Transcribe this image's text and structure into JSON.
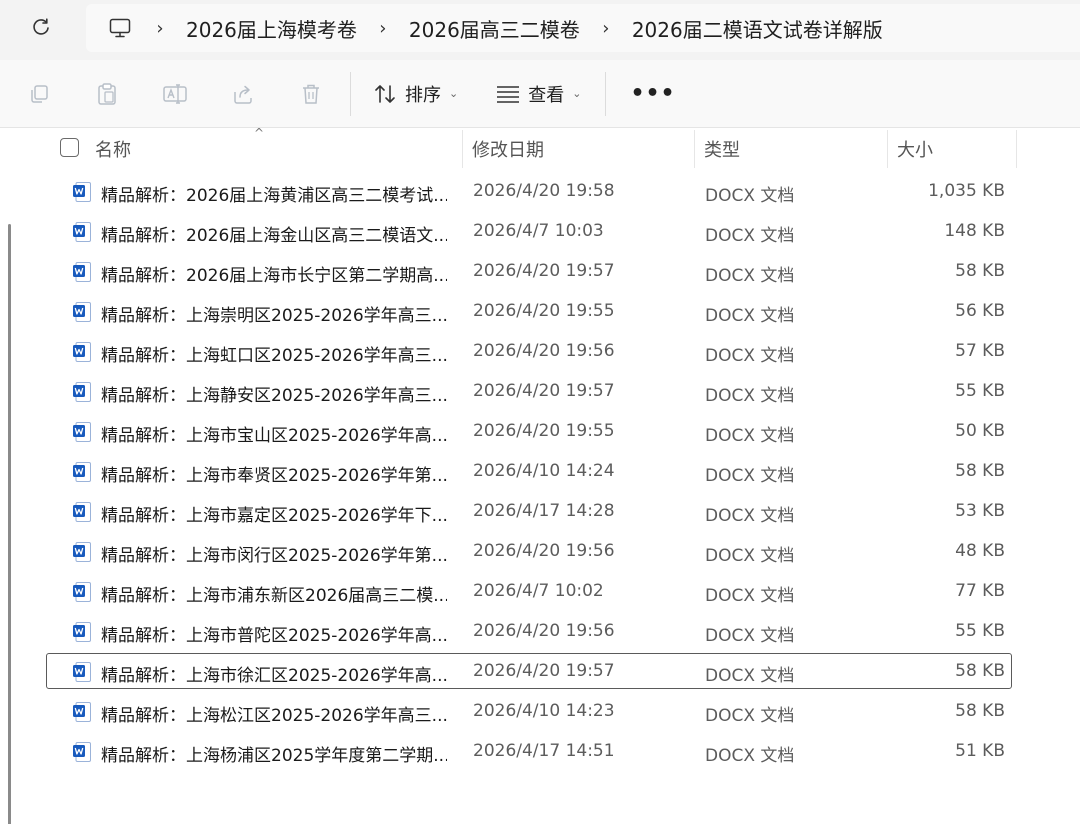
{
  "breadcrumbs": [
    "2026届上海模考卷",
    "2026届高三二模卷",
    "2026届二模语文试卷详解版"
  ],
  "toolbar": {
    "sort_label": "排序",
    "view_label": "查看",
    "more_label": "•••"
  },
  "columns": {
    "name": "名称",
    "date": "修改日期",
    "type": "类型",
    "size": "大小"
  },
  "files": [
    {
      "name": "精品解析：2026届上海黄浦区高三二模考试...",
      "date": "2026/4/20 19:58",
      "type": "DOCX 文档",
      "size": "1,035 KB"
    },
    {
      "name": "精品解析：2026届上海金山区高三二模语文...",
      "date": "2026/4/7 10:03",
      "type": "DOCX 文档",
      "size": "148 KB"
    },
    {
      "name": "精品解析：2026届上海市长宁区第二学期高...",
      "date": "2026/4/20 19:57",
      "type": "DOCX 文档",
      "size": "58 KB"
    },
    {
      "name": "精品解析：上海崇明区2025-2026学年高三...",
      "date": "2026/4/20 19:55",
      "type": "DOCX 文档",
      "size": "56 KB"
    },
    {
      "name": "精品解析：上海虹口区2025-2026学年高三...",
      "date": "2026/4/20 19:56",
      "type": "DOCX 文档",
      "size": "57 KB"
    },
    {
      "name": "精品解析：上海静安区2025-2026学年高三...",
      "date": "2026/4/20 19:57",
      "type": "DOCX 文档",
      "size": "55 KB"
    },
    {
      "name": "精品解析：上海市宝山区2025-2026学年高...",
      "date": "2026/4/20 19:55",
      "type": "DOCX 文档",
      "size": "50 KB"
    },
    {
      "name": "精品解析：上海市奉贤区2025-2026学年第...",
      "date": "2026/4/10 14:24",
      "type": "DOCX 文档",
      "size": "58 KB"
    },
    {
      "name": "精品解析：上海市嘉定区2025-2026学年下...",
      "date": "2026/4/17 14:28",
      "type": "DOCX 文档",
      "size": "53 KB"
    },
    {
      "name": "精品解析：上海市闵行区2025-2026学年第...",
      "date": "2026/4/20 19:56",
      "type": "DOCX 文档",
      "size": "48 KB"
    },
    {
      "name": "精品解析：上海市浦东新区2026届高三二模...",
      "date": "2026/4/7 10:02",
      "type": "DOCX 文档",
      "size": "77 KB"
    },
    {
      "name": "精品解析：上海市普陀区2025-2026学年高...",
      "date": "2026/4/20 19:56",
      "type": "DOCX 文档",
      "size": "55 KB"
    },
    {
      "name": "精品解析：上海市徐汇区2025-2026学年高...",
      "date": "2026/4/20 19:57",
      "type": "DOCX 文档",
      "size": "58 KB",
      "selected": true
    },
    {
      "name": "精品解析：上海松江区2025-2026学年高三...",
      "date": "2026/4/10 14:23",
      "type": "DOCX 文档",
      "size": "58 KB"
    },
    {
      "name": "精品解析：上海杨浦区2025学年度第二学期...",
      "date": "2026/4/17 14:51",
      "type": "DOCX 文档",
      "size": "51 KB"
    }
  ],
  "colors": {
    "word_blue": "#185abd",
    "toolbar_icon_gray": "#b8bfc8",
    "selection_border": "#5a5a5a"
  }
}
